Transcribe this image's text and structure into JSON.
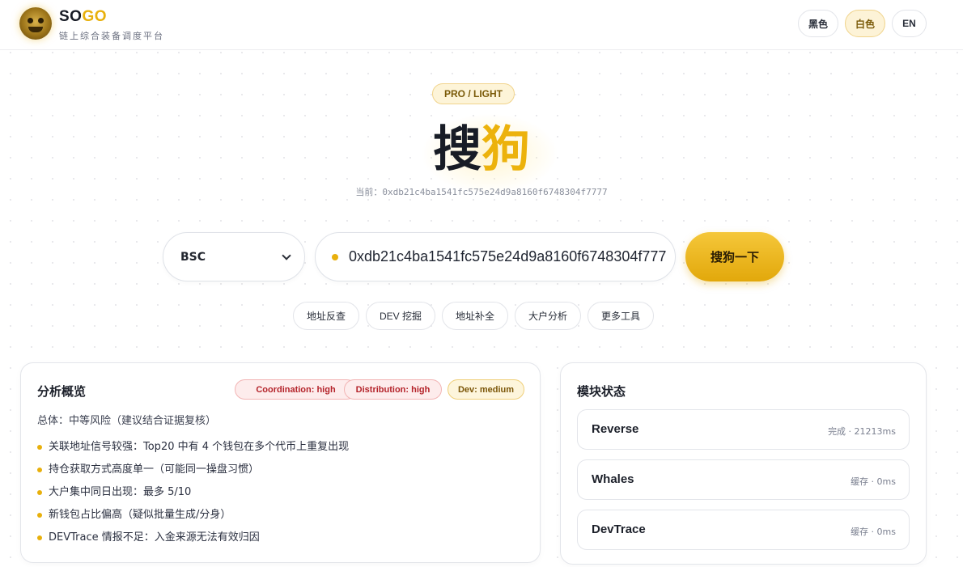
{
  "header": {
    "brand_so": "SO",
    "brand_go": "GO",
    "brand_subtitle": "链上综合装备调度平台",
    "theme_dark": "黑色",
    "theme_light": "白色",
    "language": "EN"
  },
  "hero": {
    "badge": "PRO / LIGHT",
    "title_part1": "搜",
    "title_part2": "狗",
    "current_label": "当前：",
    "current_address": "0xdb21c4ba1541fc575e24d9a8160f6748304f7777"
  },
  "search": {
    "chain_value": "BSC",
    "query_value": "0xdb21c4ba1541fc575e24d9a8160f6748304f7777",
    "button_label": "搜狗一下"
  },
  "tools": {
    "reverse_lookup": "地址反查",
    "dev_mining": "DEV 挖掘",
    "address_complete": "地址补全",
    "whale_analysis": "大户分析",
    "more_tools": "更多工具"
  },
  "overview": {
    "title": "分析概览",
    "tags": {
      "coordination": "Coordination: high",
      "distribution": "Distribution: high",
      "dev": "Dev: medium"
    },
    "overall": "总体：中等风险（建议结合证据复核）",
    "findings": [
      "关联地址信号较强：Top20 中有 4 个钱包在多个代币上重复出现",
      "持仓获取方式高度单一（可能同一操盘习惯）",
      "大户集中同日出现：最多 5/10",
      "新钱包占比偏高（疑似批量生成/分身）",
      "DEVTrace 情报不足：入金来源无法有效归因"
    ]
  },
  "modules": {
    "title": "模块状态",
    "items": [
      {
        "name": "Reverse",
        "status": "完成 · 21213ms"
      },
      {
        "name": "Whales",
        "status": "缓存 · 0ms"
      },
      {
        "name": "DevTrace",
        "status": "缓存 · 0ms"
      }
    ]
  },
  "colors": {
    "accent": "#ecb20c",
    "risk_high": "#b4232a",
    "risk_medium": "#7b5608"
  }
}
